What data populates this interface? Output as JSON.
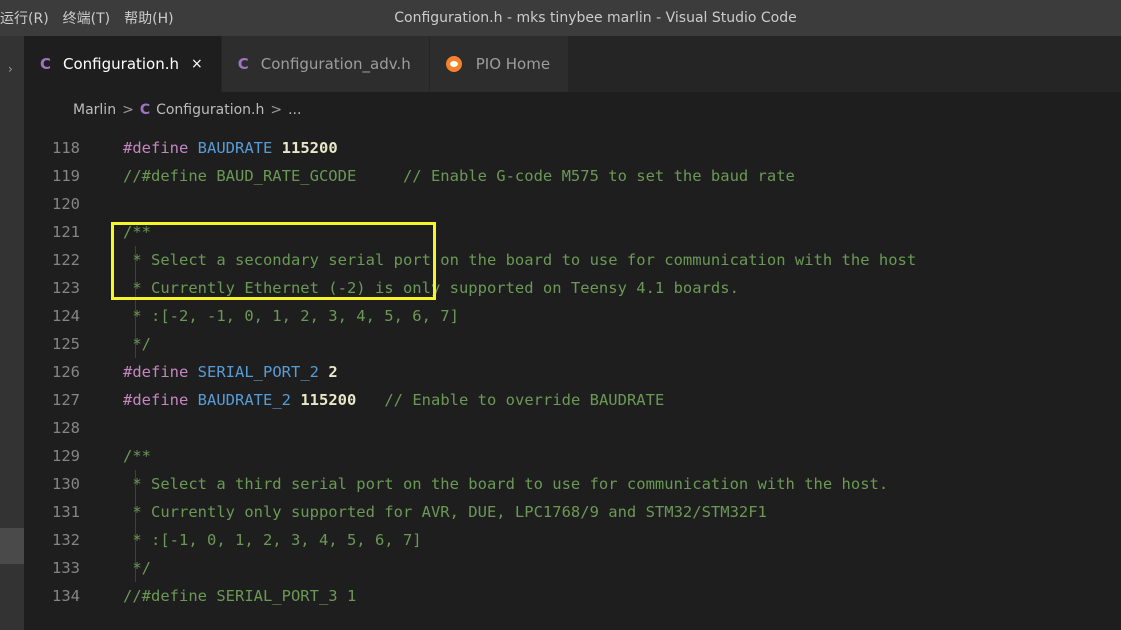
{
  "menu": [
    "运行(R)",
    "终端(T)",
    "帮助(H)"
  ],
  "window_title": "Configuration.h - mks tinybee marlin - Visual Studio Code",
  "tabs": [
    {
      "label": "Configuration.h",
      "icon": "c-file-icon",
      "close": "×"
    },
    {
      "label": "Configuration_adv.h",
      "icon": "c-file-icon"
    },
    {
      "label": "PIO Home",
      "icon": "platformio-icon"
    }
  ],
  "breadcrumb": {
    "folder": "Marlin",
    "sep": ">",
    "file": "Configuration.h",
    "more": "..."
  },
  "icon_glyph": "C",
  "highlight_color": "#f5f52a",
  "code": [
    {
      "n": "118",
      "t": "#define BAUDRATE 115200"
    },
    {
      "n": "119",
      "t": "//#define BAUD_RATE_GCODE     // Enable G-code M575 to set the baud rate"
    },
    {
      "n": "120",
      "t": ""
    },
    {
      "n": "121",
      "t": "/**"
    },
    {
      "n": "122",
      "t": " * Select a secondary serial port on the board to use for communication with the host"
    },
    {
      "n": "123",
      "t": " * Currently Ethernet (-2) is only supported on Teensy 4.1 boards."
    },
    {
      "n": "124",
      "t": " * :[-2, -1, 0, 1, 2, 3, 4, 5, 6, 7]"
    },
    {
      "n": "125",
      "t": " */"
    },
    {
      "n": "126",
      "t": "#define SERIAL_PORT_2 2"
    },
    {
      "n": "127",
      "t": "#define BAUDRATE_2 115200   // Enable to override BAUDRATE"
    },
    {
      "n": "128",
      "t": ""
    },
    {
      "n": "129",
      "t": "/**"
    },
    {
      "n": "130",
      "t": " * Select a third serial port on the board to use for communication with the host."
    },
    {
      "n": "131",
      "t": " * Currently only supported for AVR, DUE, LPC1768/9 and STM32/STM32F1"
    },
    {
      "n": "132",
      "t": " * :[-1, 0, 1, 2, 3, 4, 5, 6, 7]"
    },
    {
      "n": "133",
      "t": " */"
    },
    {
      "n": "134",
      "t": "//#define SERIAL_PORT_3 1"
    }
  ]
}
